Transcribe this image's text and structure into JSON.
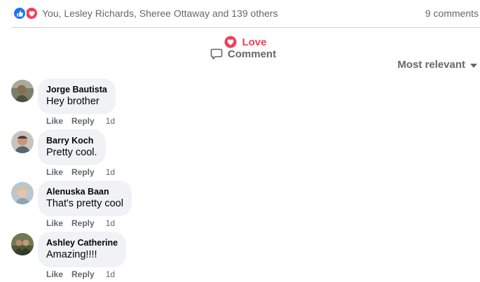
{
  "summary": {
    "reactions_text": "You, Lesley Richards, Sheree Ottaway and 139 others",
    "comment_count": "9 comments",
    "reaction_icons": [
      "like-icon",
      "love-icon"
    ],
    "colors": {
      "like": "#1877f2",
      "love": "#f33e58"
    }
  },
  "actions": {
    "love_label": "Love",
    "comment_label": "Comment"
  },
  "sort": {
    "label": "Most relevant"
  },
  "comments": [
    {
      "author": "Jorge Bautista",
      "text": "Hey brother",
      "like": "Like",
      "reply": "Reply",
      "time": "1d"
    },
    {
      "author": "Barry Koch",
      "text": "Pretty cool.",
      "like": "Like",
      "reply": "Reply",
      "time": "1d"
    },
    {
      "author": "Alenuska Baan",
      "text": "That's pretty cool",
      "like": "Like",
      "reply": "Reply",
      "time": "1d"
    },
    {
      "author": "Ashley Catherine",
      "text": "Amazing!!!!",
      "like": "Like",
      "reply": "Reply",
      "time": "1d"
    }
  ]
}
